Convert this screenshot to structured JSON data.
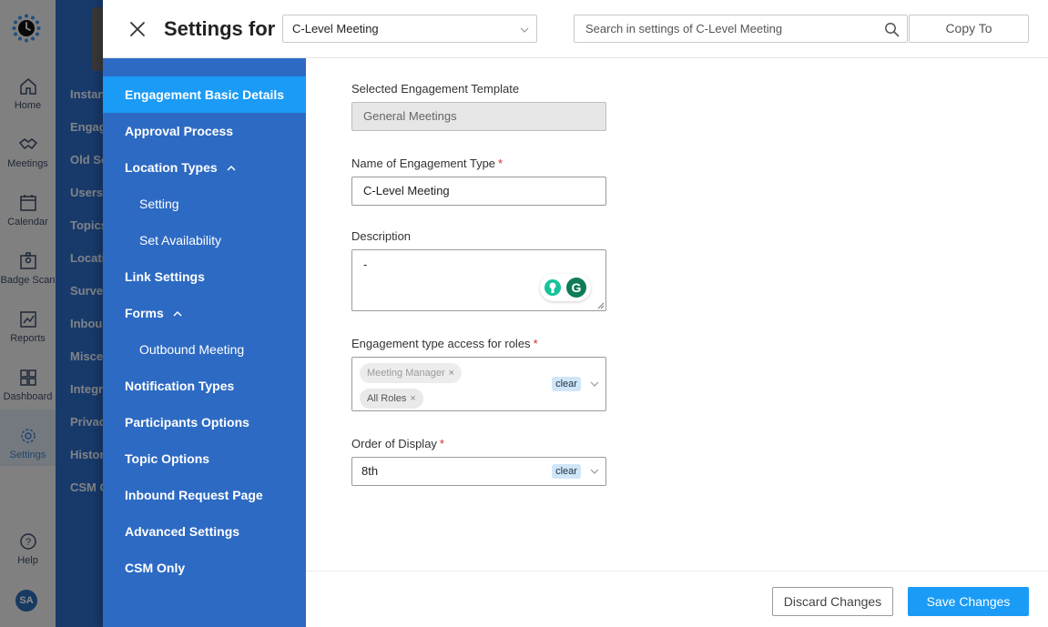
{
  "background_app": {
    "rail": [
      {
        "label": "Home",
        "icon": "home-icon"
      },
      {
        "label": "Meetings",
        "icon": "handshake-icon"
      },
      {
        "label": "Calendar",
        "icon": "calendar-icon"
      },
      {
        "label": "Badge Scan",
        "icon": "badge-icon"
      },
      {
        "label": "Reports",
        "icon": "reports-icon"
      },
      {
        "label": "Dashboard",
        "icon": "dashboard-icon"
      },
      {
        "label": "Settings",
        "icon": "gear-icon",
        "active": true
      }
    ],
    "help_label": "Help",
    "avatar_initials": "SA",
    "nav_items": [
      "Instan",
      "Engag",
      "Old Se",
      "Users",
      "Topics",
      "Locati",
      "Surve",
      "Inbou",
      "Misce",
      "Integr",
      "Privac",
      "Histor",
      "CSM C"
    ]
  },
  "header": {
    "title": "Settings for",
    "engagement_select_value": "C-Level Meeting",
    "search_placeholder": "Search in settings of C-Level Meeting",
    "copy_to_label": "Copy To"
  },
  "sidebar": {
    "items": [
      {
        "label": "Engagement Basic Details",
        "active": true
      },
      {
        "label": "Approval Process"
      },
      {
        "label": "Location Types",
        "expanded": true
      },
      {
        "label": "Setting",
        "sub": true
      },
      {
        "label": "Set Availability",
        "sub": true
      },
      {
        "label": "Link Settings"
      },
      {
        "label": "Forms",
        "expanded": true
      },
      {
        "label": "Outbound Meeting",
        "sub": true
      },
      {
        "label": "Notification Types"
      },
      {
        "label": "Participants Options"
      },
      {
        "label": "Topic Options"
      },
      {
        "label": "Inbound Request Page"
      },
      {
        "label": "Advanced Settings"
      },
      {
        "label": "CSM Only"
      }
    ]
  },
  "form": {
    "template_label": "Selected Engagement Template",
    "template_value": "General Meetings",
    "name_label": "Name of Engagement Type",
    "name_value": "C-Level Meeting",
    "description_label": "Description",
    "description_value": "-",
    "roles_label": "Engagement type access for roles",
    "roles_chips": [
      "Meeting Manager",
      "All Roles"
    ],
    "clear_label": "clear",
    "order_label": "Order of Display",
    "order_value": "8th",
    "required_mark": "*"
  },
  "footer": {
    "discard_label": "Discard Changes",
    "save_label": "Save Changes"
  },
  "colors": {
    "brand_blue": "#2d6ac3",
    "active_blue": "#1a9bf6",
    "required_red": "#d9262b"
  }
}
